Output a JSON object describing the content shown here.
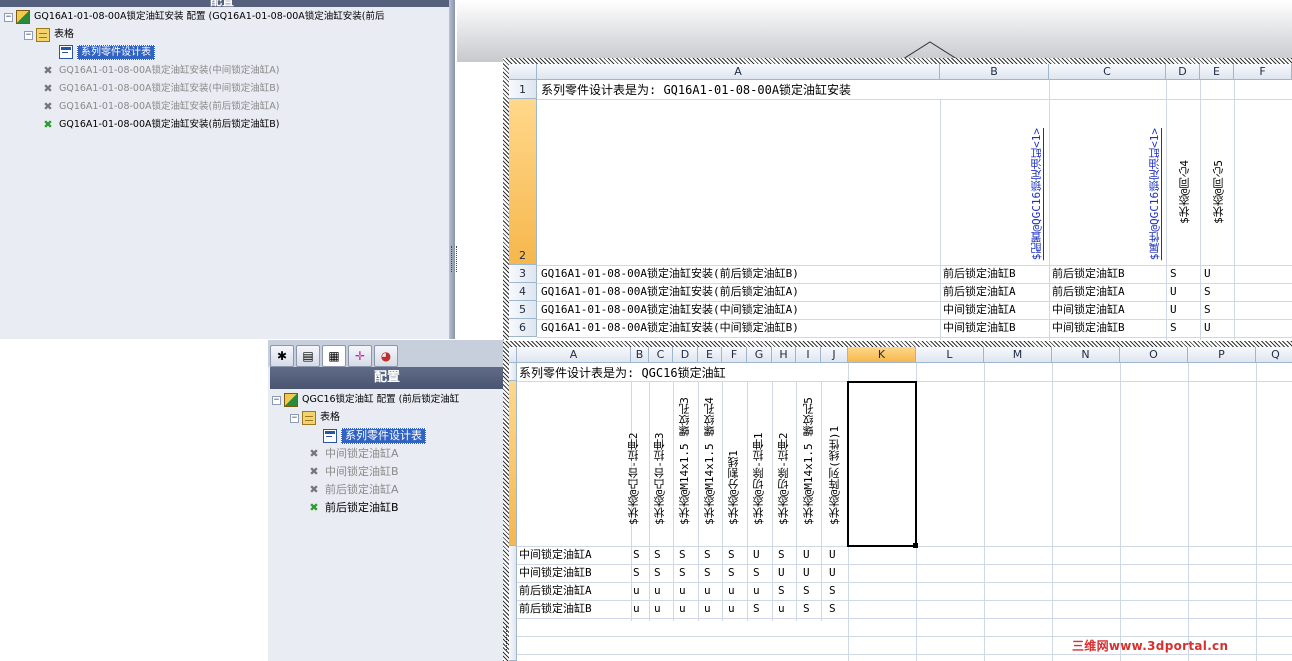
{
  "top_panel": {
    "header_fragment": "配置",
    "root_label": "GQ16A1-01-08-00A锁定油缸安装 配置  (GQ16A1-01-08-00A锁定油缸安装(前后",
    "tables_label": "表格",
    "design_table_label": "系列零件设计表",
    "configs": [
      {
        "label": "GQ16A1-01-08-00A锁定油缸安装(中间锁定油缸A)",
        "active": false
      },
      {
        "label": "GQ16A1-01-08-00A锁定油缸安装(中间锁定油缸B)",
        "active": false
      },
      {
        "label": "GQ16A1-01-08-00A锁定油缸安装(前后锁定油缸A)",
        "active": false
      },
      {
        "label": "GQ16A1-01-08-00A锁定油缸安装(前后锁定油缸B)",
        "active": true
      }
    ]
  },
  "bottom_panel": {
    "title": "配置",
    "tab_icons": [
      "feature-tree-icon",
      "property-manager-icon",
      "configuration-manager-icon",
      "dimxpert-icon",
      "display-manager-icon"
    ],
    "root_label": "QGC16锁定油缸 配置  (前后锁定油缸",
    "tables_label": "表格",
    "design_table_label": "系列零件设计表",
    "configs": [
      {
        "label": "中间锁定油缸A",
        "active": false
      },
      {
        "label": "中间锁定油缸B",
        "active": false
      },
      {
        "label": "前后锁定油缸A",
        "active": false
      },
      {
        "label": "前后锁定油缸B",
        "active": true
      }
    ]
  },
  "sheet_top": {
    "columns": [
      "A",
      "B",
      "C",
      "D",
      "E",
      "F"
    ],
    "rows": [
      "1",
      "2",
      "3",
      "4",
      "5",
      "6"
    ],
    "title_cell": "系列零件设计表是为:  GQ16A1-01-08-00A锁定油缸安装",
    "headers_vertical": [
      "$配置@QGC16锁定油缸<1>",
      "$属性@QGC16锁定油缸<1>",
      "$状态@同心4",
      "$状态@同心5"
    ],
    "data": [
      [
        "GQ16A1-01-08-00A锁定油缸安装(前后锁定油缸B)",
        "前后锁定油缸B",
        "前后锁定油缸B",
        "S",
        "U"
      ],
      [
        "GQ16A1-01-08-00A锁定油缸安装(前后锁定油缸A)",
        "前后锁定油缸A",
        "前后锁定油缸A",
        "U",
        "S"
      ],
      [
        "GQ16A1-01-08-00A锁定油缸安装(中间锁定油缸A)",
        "中间锁定油缸A",
        "中间锁定油缸A",
        "U",
        "S"
      ],
      [
        "GQ16A1-01-08-00A锁定油缸安装(中间锁定油缸B)",
        "中间锁定油缸B",
        "中间锁定油缸B",
        "S",
        "U"
      ]
    ]
  },
  "sheet_bottom": {
    "columns": [
      "A",
      "B",
      "C",
      "D",
      "E",
      "F",
      "G",
      "H",
      "I",
      "J",
      "K",
      "L",
      "M",
      "N",
      "O",
      "P",
      "Q"
    ],
    "title_cell": "系列零件设计表是为:  QGC16锁定油缸",
    "headers_vertical": [
      "$状态@凸台-拉伸2",
      "$状态@凸台-拉伸3",
      "$状态@M14x1.5 螺纹孔3",
      "$状态@M14x1.5 螺纹孔4",
      "$状态@分割线1",
      "$状态@切除-拉伸1",
      "$状态@切除-拉伸2",
      "$状态@M14x1.5 螺纹孔5",
      "$状态@阵列(线性)1"
    ],
    "data": [
      [
        "中间锁定油缸A",
        "S",
        "S",
        "S",
        "S",
        "S",
        "U",
        "S",
        "U",
        "U"
      ],
      [
        "中间锁定油缸B",
        "S",
        "S",
        "S",
        "S",
        "S",
        "S",
        "U",
        "U",
        "U"
      ],
      [
        "前后锁定油缸A",
        "u",
        "u",
        "u",
        "u",
        "u",
        "u",
        "S",
        "S",
        "S"
      ],
      [
        "前后锁定油缸B",
        "u",
        "u",
        "u",
        "u",
        "u",
        "S",
        "u",
        "S",
        "S"
      ]
    ]
  },
  "watermark": "三维网www.3dportal.cn",
  "colors": {
    "panel_bg": "#e9ecf3",
    "selection": "#3163c5",
    "header_highlight": "#f6b74d",
    "watermark": "#d63030"
  }
}
